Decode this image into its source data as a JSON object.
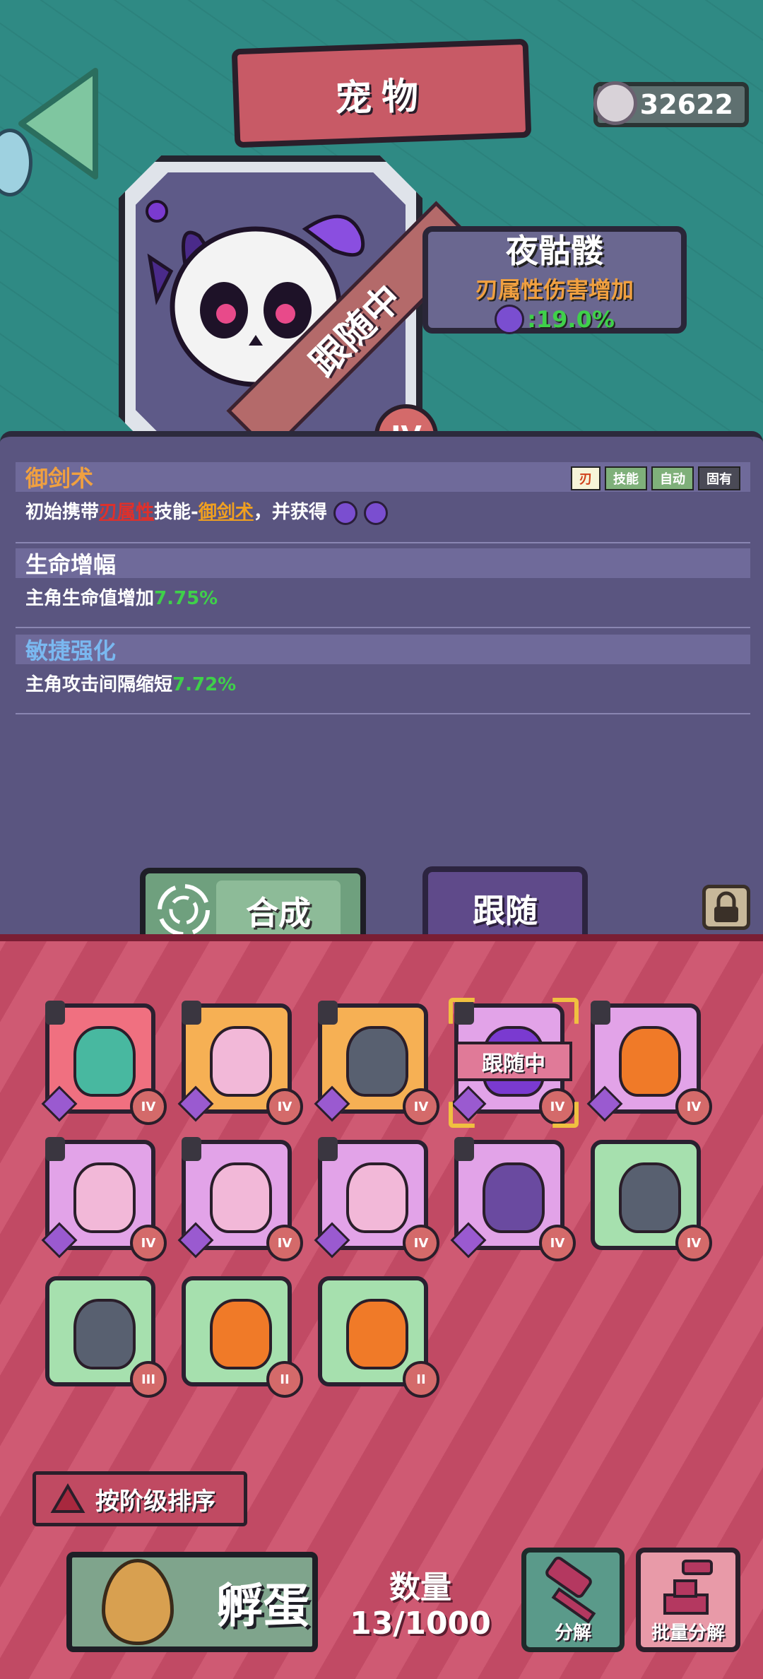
{
  "header": {
    "title": "宠物",
    "currency_amount": "32622",
    "currency_icon": "orb-coin-icon"
  },
  "featured_pet": {
    "name": "夜骷髅",
    "bonus_text": "刃属性伤害增加",
    "bonus_value": ":19.0%",
    "status_ribbon": "跟随中",
    "tier": "IV"
  },
  "skills": [
    {
      "title": "御剑术",
      "title_color": "#f0a040",
      "tags": [
        "刃",
        "技能",
        "自动",
        "固有"
      ],
      "desc_prefix": "初始携带",
      "desc_hl1": "刃属性",
      "desc_mid": "技能-",
      "desc_hl2": "御剑术",
      "desc_suffix": "，并获得"
    },
    {
      "title": "生命增幅",
      "title_color": "#ffffff",
      "desc_prefix": "主角生命值增加",
      "desc_value": "7.75%"
    },
    {
      "title": "敏捷强化",
      "title_color": "#7ab8f0",
      "desc_prefix": "主角攻击间隔缩短",
      "desc_value": "7.72%"
    }
  ],
  "actions": {
    "combine_label": "合成",
    "follow_label": "跟随"
  },
  "pet_cards": [
    {
      "color": "red",
      "tier": "IV",
      "locked": true,
      "creature": "spring-totem"
    },
    {
      "color": "orange",
      "tier": "IV",
      "locked": true,
      "creature": "fairy"
    },
    {
      "color": "orange",
      "tier": "IV",
      "locked": true,
      "creature": "drone"
    },
    {
      "color": "pink",
      "tier": "IV",
      "locked": true,
      "creature": "skull",
      "following_label": "跟随中",
      "selected": true
    },
    {
      "color": "pink",
      "tier": "IV",
      "locked": true,
      "creature": "pumpkin-imp"
    },
    {
      "color": "pink",
      "tier": "IV",
      "locked": true,
      "creature": "fairy"
    },
    {
      "color": "pink",
      "tier": "IV",
      "locked": true,
      "creature": "fairy"
    },
    {
      "color": "pink",
      "tier": "IV",
      "locked": true,
      "creature": "fairy"
    },
    {
      "color": "pink",
      "tier": "IV",
      "locked": true,
      "creature": "horn-blob"
    },
    {
      "color": "green",
      "tier": "IV",
      "locked": false,
      "creature": "drone"
    },
    {
      "color": "green",
      "tier": "III",
      "locked": false,
      "creature": "drone"
    },
    {
      "color": "green",
      "tier": "II",
      "locked": false,
      "creature": "pumpkin-imp"
    },
    {
      "color": "green",
      "tier": "II",
      "locked": false,
      "creature": "pumpkin-imp"
    }
  ],
  "footer": {
    "sort_label": "按阶级排序",
    "hatch_label": "孵蛋",
    "count_title": "数量",
    "count_value": "13/1000",
    "disassemble_label": "分解",
    "batch_disassemble_label": "批量分解"
  }
}
